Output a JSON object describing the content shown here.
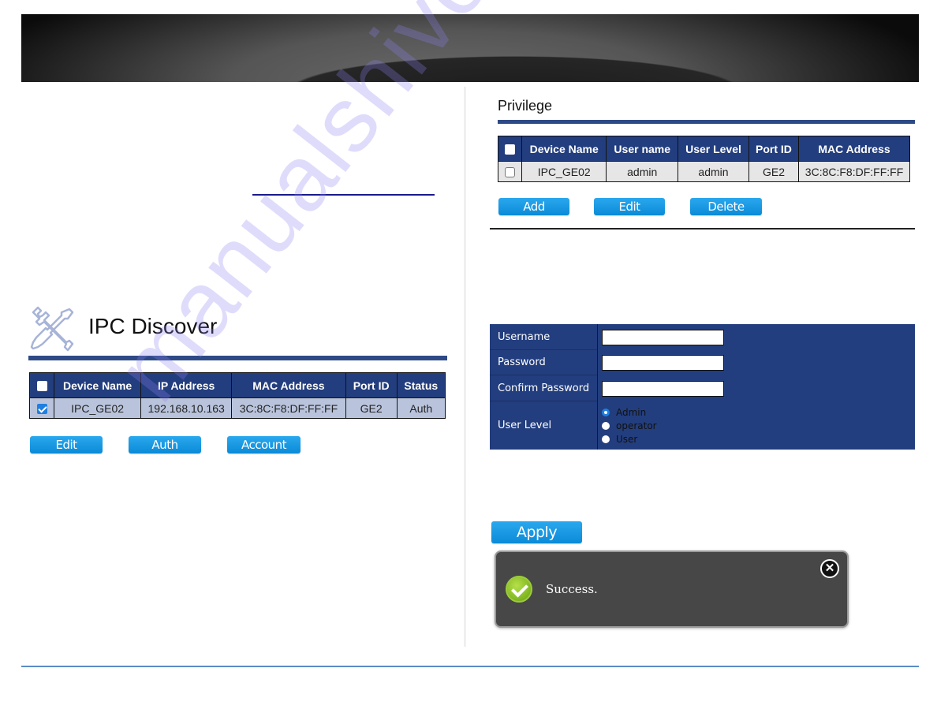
{
  "watermark": "manualshive.com",
  "ipc_discover": {
    "title": "IPC Discover",
    "icon": "tools-icon",
    "table": {
      "columns": [
        "",
        "Device Name",
        "IP Address",
        "MAC Address",
        "Port ID",
        "Status"
      ],
      "rows": [
        {
          "checked": true,
          "device_name": "IPC_GE02",
          "ip_address": "192.168.10.163",
          "mac_address": "3C:8C:F8:DF:FF:FF",
          "port_id": "GE2",
          "status": "Auth"
        }
      ]
    },
    "buttons": {
      "edit": "Edit",
      "auth": "Auth",
      "account": "Account"
    }
  },
  "privilege": {
    "title": "Privilege",
    "table": {
      "columns": [
        "",
        "Device Name",
        "User name",
        "User Level",
        "Port ID",
        "MAC Address"
      ],
      "rows": [
        {
          "checked": false,
          "device_name": "IPC_GE02",
          "user_name": "admin",
          "user_level": "admin",
          "port_id": "GE2",
          "mac_address": "3C:8C:F8:DF:FF:FF"
        }
      ]
    },
    "buttons": {
      "add": "Add",
      "edit": "Edit",
      "delete": "Delete"
    }
  },
  "account_form": {
    "username_label": "Username",
    "username_value": "",
    "password_label": "Password",
    "password_value": "",
    "confirm_password_label": "Confirm Password",
    "confirm_password_value": "",
    "user_level_label": "User Level",
    "user_level_options": [
      "Admin",
      "operator",
      "User"
    ],
    "user_level_selected": "Admin",
    "apply_label": "Apply"
  },
  "toast": {
    "message": "Success.",
    "icon": "success-check-icon",
    "close_icon": "close-icon"
  },
  "colors": {
    "header_blue": "#233e7e",
    "button_blue": "#0b8ad8",
    "footer_rule": "#5b8cc6"
  }
}
